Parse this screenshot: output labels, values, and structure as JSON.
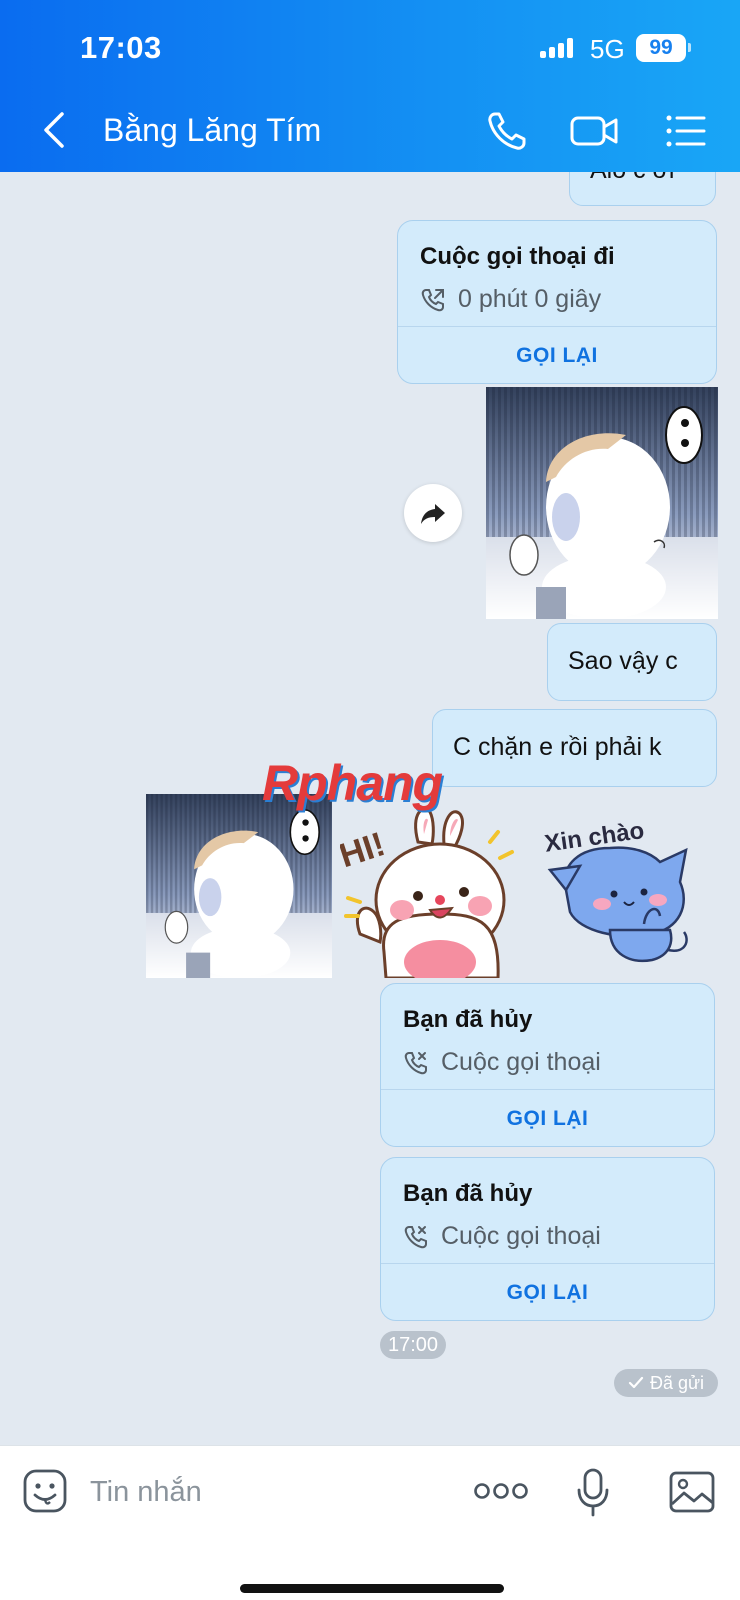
{
  "status_bar": {
    "time": "17:03",
    "network": "5G",
    "battery": "99"
  },
  "header": {
    "title": "Bằng Lăng Tím"
  },
  "messages": {
    "partial_text": "Alo c ơi",
    "call1": {
      "title": "Cuộc gọi thoại đi",
      "subtitle": "0 phút 0 giây",
      "action": "GỌI LẠI"
    },
    "text1": "Sao vậy c",
    "text2": "C chặn e rồi phải k",
    "sticker_hi": "HI!",
    "sticker_xin_chao": "Xin chào",
    "watermark": "Rphang",
    "call2": {
      "title": "Bạn đã hủy",
      "subtitle": "Cuộc gọi thoại",
      "action": "GỌI LẠI"
    },
    "call3": {
      "title": "Bạn đã hủy",
      "subtitle": "Cuộc gọi thoại",
      "action": "GỌI LẠI"
    },
    "time": "17:00",
    "sent_status": "Đã gửi"
  },
  "input": {
    "placeholder": "Tin nhắn"
  },
  "colors": {
    "header": "#0a6cf0",
    "bubble": "#d3ebfb",
    "accent": "#1072e0",
    "chat_bg": "#e2e9f1"
  },
  "icons": [
    "back-icon",
    "phone-icon",
    "video-icon",
    "menu-icon",
    "forward-icon",
    "call-outgoing-icon",
    "call-cancelled-icon",
    "sticker-icon",
    "more-icon",
    "mic-icon",
    "image-icon"
  ]
}
